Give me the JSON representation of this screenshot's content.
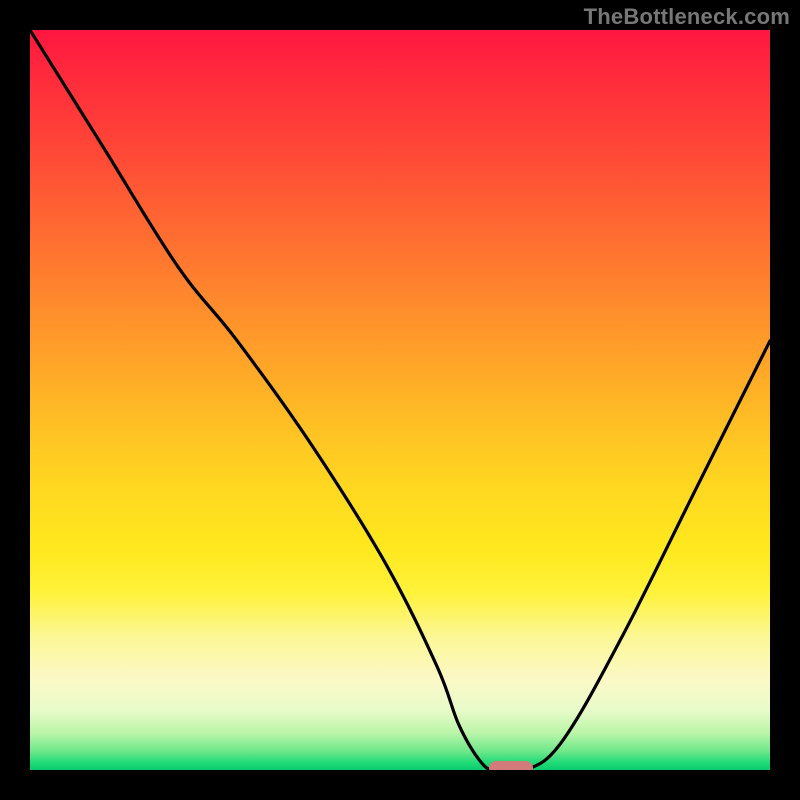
{
  "watermark": "TheBottleneck.com",
  "chart_data": {
    "type": "line",
    "title": "",
    "xlabel": "",
    "ylabel": "",
    "xlim": [
      0,
      100
    ],
    "ylim": [
      0,
      100
    ],
    "series": [
      {
        "name": "bottleneck-curve",
        "x": [
          0,
          10,
          20,
          28,
          38,
          48,
          55,
          58,
          61,
          63,
          67,
          72,
          80,
          90,
          100
        ],
        "y": [
          100,
          84,
          68,
          58,
          44,
          28,
          14,
          6,
          1,
          0,
          0,
          4,
          18,
          38,
          58
        ]
      }
    ],
    "marker": {
      "x_start": 62,
      "x_end": 68,
      "y": 0,
      "color": "#d37a7a"
    },
    "background_gradient": {
      "orientation": "vertical",
      "stops": [
        {
          "pos": 0.0,
          "color": "#ff1640"
        },
        {
          "pos": 0.3,
          "color": "#ff8e2c"
        },
        {
          "pos": 0.62,
          "color": "#ffd820"
        },
        {
          "pos": 0.88,
          "color": "#fbf9c8"
        },
        {
          "pos": 1.0,
          "color": "#0cc96e"
        }
      ]
    }
  }
}
